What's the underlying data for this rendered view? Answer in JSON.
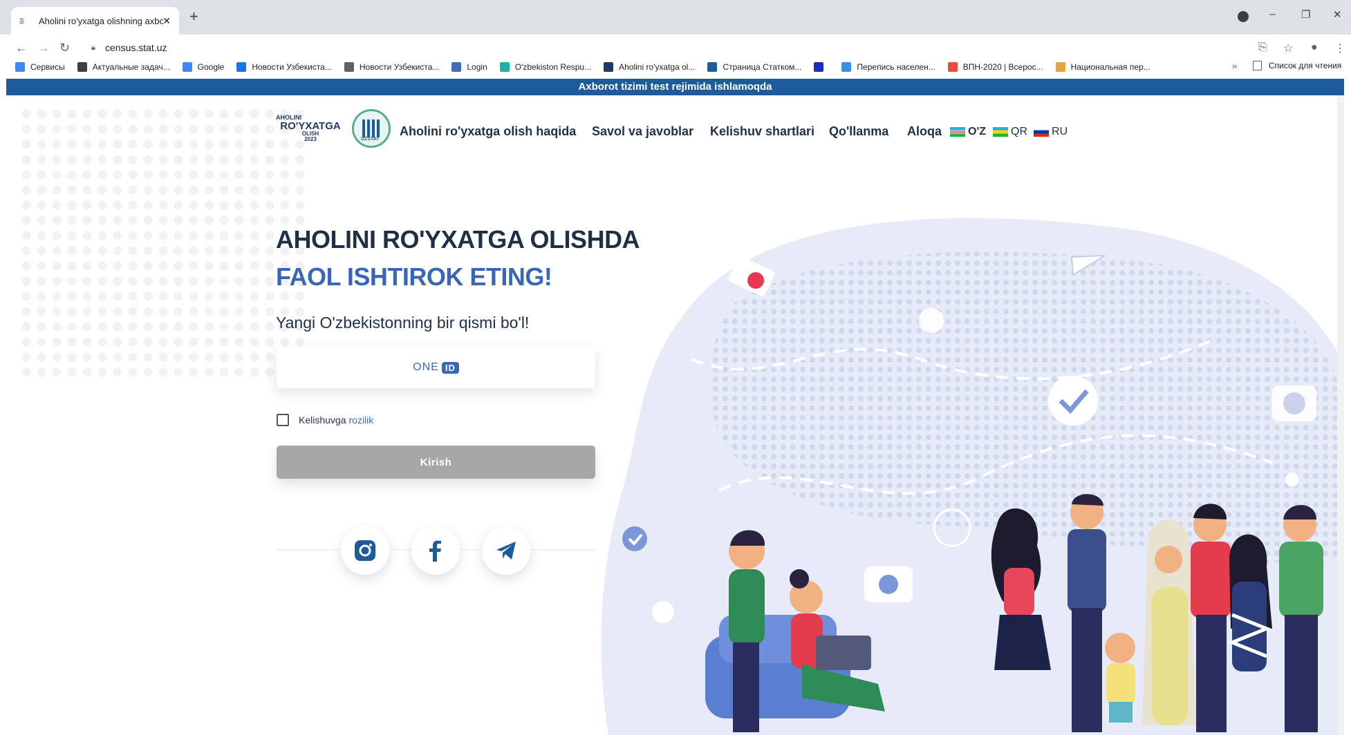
{
  "browser": {
    "tab_title": "Aholini ro'yxatga olishning axbor",
    "new_tab_icon": "plus-icon",
    "url": "census.stat.uz",
    "bookmarks": [
      {
        "label": "Сервисы",
        "color": "#4285f4"
      },
      {
        "label": "Актуальные задач...",
        "color": "#3c4043"
      },
      {
        "label": "Google",
        "color": "#4285f4"
      },
      {
        "label": "Новости Узбекиста...",
        "color": "#1a73e8"
      },
      {
        "label": "Новости Узбекиста...",
        "color": "#5f6368"
      },
      {
        "label": "Login",
        "color": "#3d6fb6"
      },
      {
        "label": "O'zbekiston Respu...",
        "color": "#1eb3a0"
      },
      {
        "label": "Aholini ro'yxatga ol...",
        "color": "#1f3a64"
      },
      {
        "label": "Страница Статком...",
        "color": "#1d5b9c"
      },
      {
        "label": "",
        "color": "#1a2fbf"
      },
      {
        "label": "Перепись населен...",
        "color": "#3a8ee6"
      },
      {
        "label": "ВПН-2020 | Всерос...",
        "color": "#e84c3d"
      },
      {
        "label": "Национальная пер...",
        "color": "#e8a33d"
      }
    ],
    "bookmarks_more": "»",
    "reading_list": "Список для чтения"
  },
  "site": {
    "banner": "Axborot tizimi test rejimida ishlamoqda",
    "logo": {
      "line1": "AHOLINI",
      "line2": "RO'YXATGA",
      "line3": "OLISH",
      "line4": "2023",
      "emblem_caption": "UZSTAT"
    },
    "nav": {
      "about": "Aholini ro'yxatga olish haqida",
      "faq": "Savol va javoblar",
      "terms": "Kelishuv shartlari",
      "manual": "Qo'llanma",
      "contact": "Aloqa"
    },
    "languages": {
      "uz": "O'Z",
      "qr": "QR",
      "ru": "RU"
    },
    "headline_line1": "AHOLINI RO'YXATGA OLISHDA",
    "headline_line2": "FAOL ISHTIROK ETING!",
    "subheadline": "Yangi O'zbekistonning bir qismi bo'l!",
    "oneid": {
      "text": "ONE",
      "badge": "ID"
    },
    "agreement": {
      "label": "Kelishuvga",
      "link": "rozilik",
      "checked": false
    },
    "login_button": "Kirish",
    "social_icons": [
      "instagram-icon",
      "facebook-icon",
      "telegram-icon"
    ],
    "colors": {
      "primary": "#1d5b9c",
      "accent": "#3a66b8",
      "text": "#1f3046",
      "button_disabled": "#a7a7a7"
    }
  }
}
